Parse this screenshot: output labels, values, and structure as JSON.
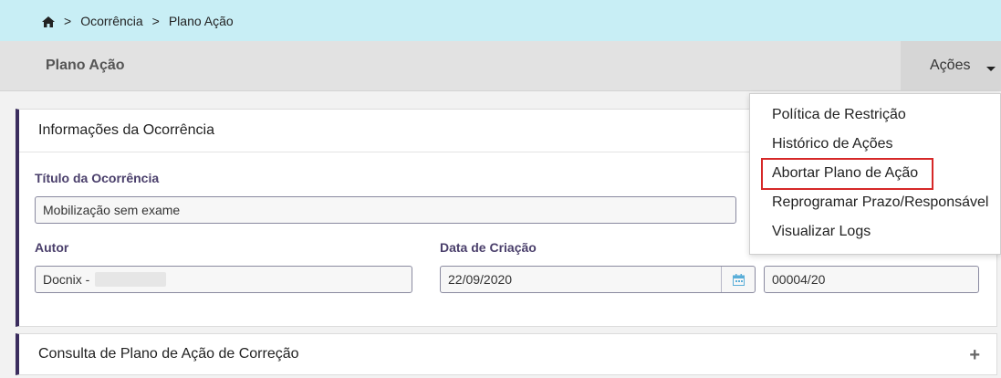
{
  "breadcrumb": {
    "home_icon": "home-icon",
    "sep": ">",
    "item1": "Ocorrência",
    "item2": "Plano Ação"
  },
  "header": {
    "title": "Plano Ação",
    "actions_label": "Ações"
  },
  "panel_info": {
    "title": "Informações da Ocorrência",
    "titulo_label": "Título da Ocorrência",
    "titulo_value": "Mobilização sem exame",
    "autor_label": "Autor",
    "autor_value": "Docnix -",
    "data_label": "Data de Criação",
    "data_value": "22/09/2020",
    "codigo_value": "00004/20"
  },
  "panel_consulta": {
    "title": "Consulta de Plano de Ação de Correção",
    "expand_icon": "plus-icon"
  },
  "actions_menu": {
    "items": [
      "Política de Restrição",
      "Histórico de Ações",
      "Abortar Plano de Ação",
      "Reprogramar Prazo/Responsável",
      "Visualizar Logs"
    ],
    "highlighted_index": 2,
    "highlight_color": "#d62828"
  }
}
